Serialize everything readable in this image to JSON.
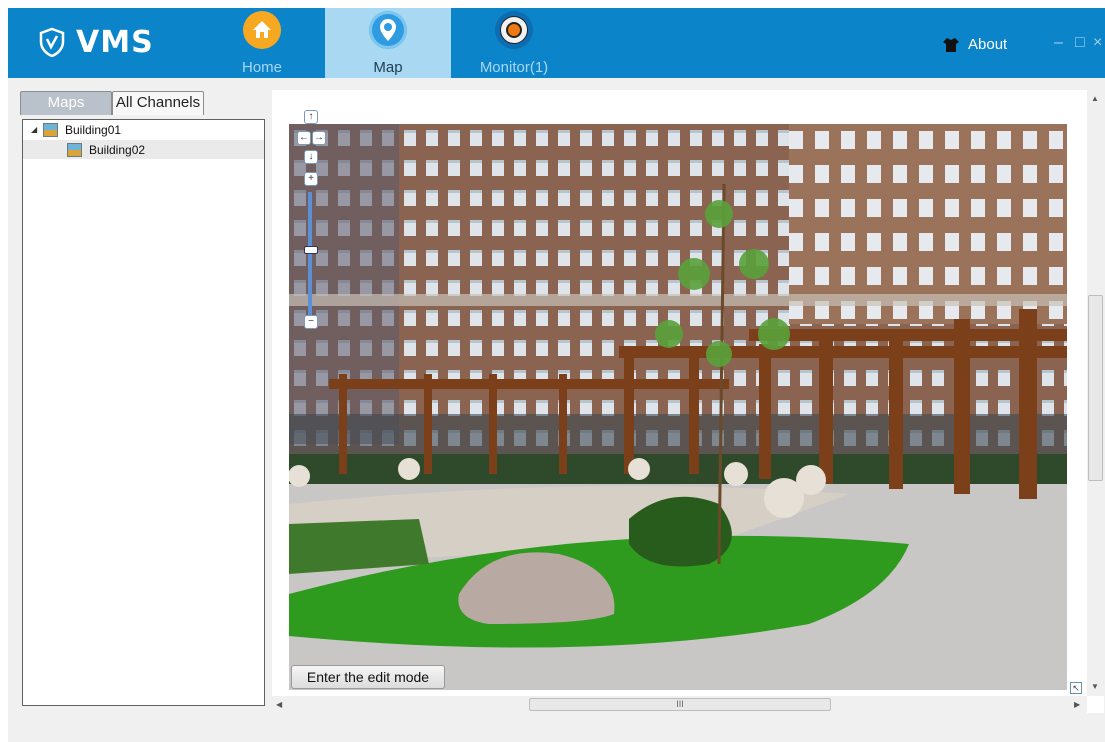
{
  "app": {
    "brand": "VMS"
  },
  "nav": {
    "tabs": [
      {
        "label": "Home",
        "icon": "home-icon"
      },
      {
        "label": "Map",
        "icon": "map-pin-icon",
        "active": true
      },
      {
        "label": "Monitor(1)",
        "icon": "camera-icon"
      }
    ],
    "about_label": "About"
  },
  "window_controls": {
    "minimize": "–",
    "maximize": "□",
    "close": "×"
  },
  "sidebar": {
    "tabs": [
      {
        "label": "Maps",
        "active": true
      },
      {
        "label": "All Channels"
      }
    ],
    "tree": [
      {
        "label": "Building01",
        "level": 0,
        "expanded": true
      },
      {
        "label": "Building02",
        "level": 1,
        "selected": true
      }
    ]
  },
  "map": {
    "edit_button": "Enter the edit mode",
    "zoom_controls": {
      "pan_up": "↑",
      "pan_left": "←",
      "pan_right": "→",
      "pan_down": "↓",
      "zoom_in": "+",
      "zoom_out": "−"
    },
    "hscroll_grip": "III"
  },
  "colors": {
    "header": "#0c84c9",
    "active_tab": "#a8d8f2",
    "home_icon": "#f6a821"
  }
}
